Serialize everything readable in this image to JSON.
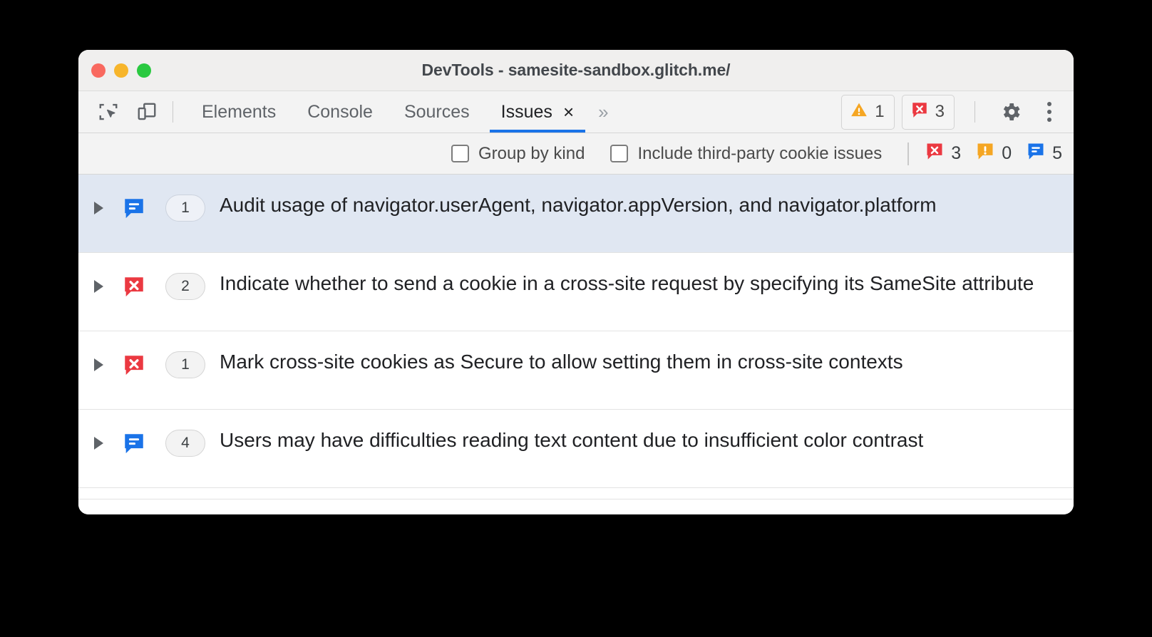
{
  "window": {
    "title": "DevTools - samesite-sandbox.glitch.me/",
    "traffic_lights": [
      "close",
      "minimize",
      "maximize"
    ]
  },
  "toolbar": {
    "inspect_icon": "inspect-element-icon",
    "device_icon": "device-toolbar-icon",
    "tabs": [
      {
        "label": "Elements",
        "active": false
      },
      {
        "label": "Console",
        "active": false
      },
      {
        "label": "Sources",
        "active": false
      },
      {
        "label": "Issues",
        "active": true,
        "closable": true
      }
    ],
    "close_glyph": "×",
    "more_tabs_glyph": "»",
    "counters": [
      {
        "icon": "warning-triangle-icon",
        "value": "1"
      },
      {
        "icon": "error-bubble-icon",
        "value": "3"
      }
    ],
    "settings_icon": "gear-icon",
    "menu_icon": "kebab-menu-icon"
  },
  "filters": {
    "checkboxes": [
      {
        "label": "Group by kind",
        "checked": false
      },
      {
        "label": "Include third-party cookie issues",
        "checked": false
      }
    ],
    "badges": [
      {
        "icon": "error-bubble-icon",
        "value": "3"
      },
      {
        "icon": "warning-bubble-icon",
        "value": "0"
      },
      {
        "icon": "info-bubble-icon",
        "value": "5"
      }
    ]
  },
  "issues": [
    {
      "kind": "info",
      "count": "1",
      "title": "Audit usage of navigator.userAgent, navigator.appVersion, and navigator.platform",
      "selected": true,
      "expanded": false
    },
    {
      "kind": "error",
      "count": "2",
      "title": "Indicate whether to send a cookie in a cross-site request by specifying its SameSite attribute",
      "selected": false,
      "expanded": false
    },
    {
      "kind": "error",
      "count": "1",
      "title": "Mark cross-site cookies as Secure to allow setting them in cross-site contexts",
      "selected": false,
      "expanded": false
    },
    {
      "kind": "info",
      "count": "4",
      "title": "Users may have difficulties reading text content due to insufficient color contrast",
      "selected": false,
      "expanded": false
    }
  ],
  "colors": {
    "accent_blue": "#1a73e8",
    "error_red": "#eb3941",
    "warning_orange": "#f5a623",
    "info_blue": "#1a73e8",
    "selected_row": "#e0e7f2",
    "titlebar": "#f0efee",
    "toolbar": "#f3f3f3"
  }
}
